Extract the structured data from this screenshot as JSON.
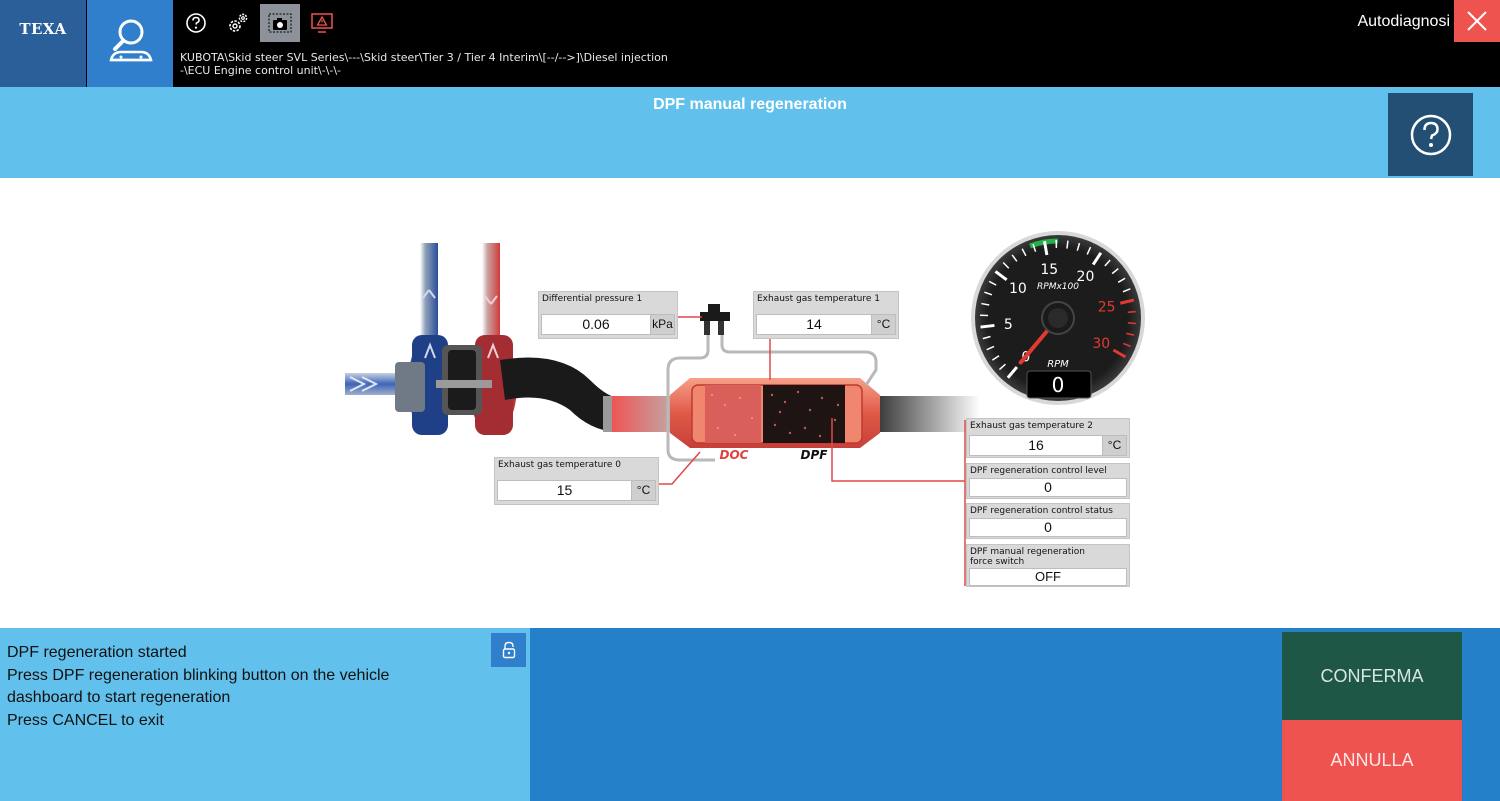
{
  "topbar": {
    "logo": "TEXA",
    "app_title": "Autodiagnosi",
    "breadcrumb_line1": "KUBOTA\\Skid steer SVL Series\\---\\Skid steer\\Tier 3 / Tier 4 Interim\\[--/-->]\\Diesel injection",
    "breadcrumb_line2": "-\\ECU Engine control unit\\-\\-\\-",
    "tools": [
      {
        "icon": "help-circle-icon"
      },
      {
        "icon": "gears-icon"
      },
      {
        "icon": "camera-icon"
      },
      {
        "icon": "warning-screen-icon"
      }
    ]
  },
  "header": {
    "title": "DPF manual regeneration"
  },
  "diagram": {
    "doc_label": "DOC",
    "dpf_label": "DPF",
    "params": [
      {
        "label": "Differential pressure 1",
        "value": "0.06",
        "unit": "kPa"
      },
      {
        "label": "Exhaust gas temperature 1",
        "value": "14",
        "unit": "°C"
      },
      {
        "label": "Exhaust gas temperature 0",
        "value": "15",
        "unit": "°C"
      },
      {
        "label": "Exhaust gas temperature 2",
        "value": "16",
        "unit": "°C"
      },
      {
        "label": "DPF regeneration control level",
        "value": "0",
        "unit": ""
      },
      {
        "label": "DPF regeneration control status",
        "value": "0",
        "unit": ""
      },
      {
        "label": "DPF manual regeneration force switch",
        "value": "OFF",
        "unit": ""
      }
    ],
    "gauge": {
      "scale_label": "RPMx100",
      "unit_label": "RPM",
      "value": "0",
      "ticks": [
        "0",
        "5",
        "10",
        "15",
        "20",
        "25",
        "30"
      ],
      "needle_value": 0,
      "min": 0,
      "max": 30
    }
  },
  "message": {
    "lines": [
      "DPF regeneration started",
      "Press DPF regeneration blinking button on the vehicle",
      "dashboard to start regeneration",
      "Press CANCEL to exit"
    ]
  },
  "buttons": {
    "confirm": "CONFERMA",
    "cancel": "ANNULLA"
  },
  "colors": {
    "topbar": "#000000",
    "header": "#62c0ec",
    "confirm": "#1f5747",
    "cancel": "#ef5350"
  }
}
